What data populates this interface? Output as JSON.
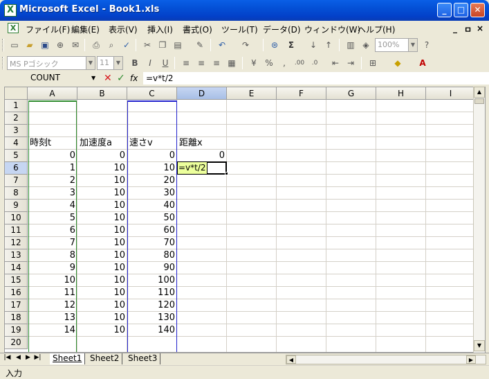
{
  "window": {
    "title": "Microsoft Excel - Book1.xls",
    "icon": "excel-icon",
    "minimize": "_",
    "maximize": "□",
    "close": "✕"
  },
  "menu": {
    "items": [
      "ファイル(F)",
      "編集(E)",
      "表示(V)",
      "挿入(I)",
      "書式(O)",
      "ツール(T)",
      "データ(D)",
      "ウィンドウ(W)",
      "ヘルプ(H)"
    ],
    "doc_min": "_",
    "doc_restore": "ㅁ",
    "doc_close": "×"
  },
  "toolbar": {
    "zoom": "100%",
    "font_name": "MS Pゴシック",
    "font_size": "11"
  },
  "formula_bar": {
    "name_box": "COUNT",
    "cancel": "✕",
    "enter": "✓",
    "fx": "fx",
    "content": "=v*t/2"
  },
  "grid": {
    "columns": [
      "A",
      "B",
      "C",
      "D",
      "E",
      "F",
      "G",
      "H",
      "I"
    ],
    "rows": [
      "1",
      "2",
      "3",
      "4",
      "5",
      "6",
      "7",
      "8",
      "9",
      "10",
      "11",
      "12",
      "13",
      "14",
      "15",
      "16",
      "17",
      "18",
      "19",
      "20"
    ],
    "active_column": "D",
    "active_row": "6",
    "headers": {
      "A4": "時刻t",
      "B4": "加速度a",
      "C4": "速さv",
      "D4": "距離x"
    },
    "col_a": [
      "0",
      "1",
      "2",
      "3",
      "4",
      "5",
      "6",
      "7",
      "8",
      "9",
      "10",
      "11",
      "12",
      "13",
      "14"
    ],
    "col_b": [
      "0",
      "10",
      "10",
      "10",
      "10",
      "10",
      "10",
      "10",
      "10",
      "10",
      "10",
      "10",
      "10",
      "10",
      "10"
    ],
    "col_c": [
      "0",
      "10",
      "20",
      "30",
      "40",
      "50",
      "60",
      "70",
      "80",
      "90",
      "100",
      "110",
      "120",
      "130",
      "140"
    ],
    "d5": "0",
    "editing_cell": "=v*t/2"
  },
  "sheets": {
    "tabs": [
      "Sheet1",
      "Sheet2",
      "Sheet3"
    ],
    "active": "Sheet1"
  },
  "status": {
    "mode": "入力"
  }
}
